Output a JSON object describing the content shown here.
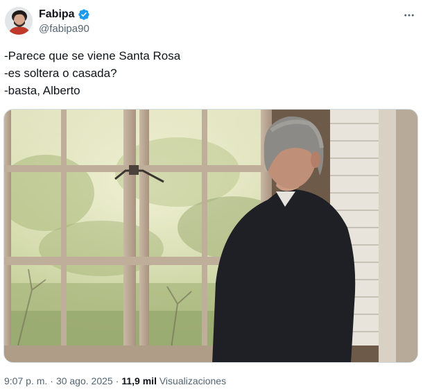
{
  "author": {
    "display_name": "Fabipa",
    "handle": "@fabipa90",
    "verified": true,
    "verified_icon": "verified-badge-icon",
    "avatar_icon": "avatar"
  },
  "menu": {
    "more_icon": "more-horizontal-icon"
  },
  "tweet": {
    "lines": [
      "-Parece que se viene Santa Rosa",
      "-es soltera o casada?",
      "-basta, Alberto"
    ]
  },
  "media": {
    "description_icon": "photo-man-at-window"
  },
  "meta": {
    "time": "9:07 p. m.",
    "separator": "·",
    "date": "30 ago. 2025",
    "views_count": "11,9 mil",
    "views_label": "Visualizaciones"
  },
  "colors": {
    "text_primary": "#0f1419",
    "text_secondary": "#536471",
    "verified_blue": "#1d9bf0",
    "border": "#cfd9de"
  }
}
